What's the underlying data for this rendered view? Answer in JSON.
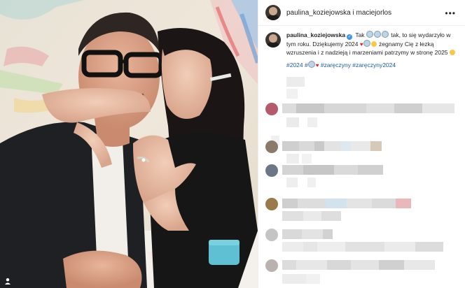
{
  "header": {
    "title": "paulina_koziejowska i maciejorlos",
    "more_icon": "more-dots-icon"
  },
  "caption": {
    "username": "paulina_koziejowska",
    "text_1": "Tak",
    "text_2": "tak, to się wydarzyło w tym roku. Dziękujemy 2024",
    "text_3": "żegnamy Cię z łezką wzruszenia i z nadzieją i marzeniami patrzymy w stronę 2025",
    "tags": "#2024 #",
    "tags_2": "#zaręczyny #zaręczyny2024"
  },
  "colors": {
    "link": "#1e5aa8",
    "verified": "#3897f0",
    "divider": "#efefef"
  }
}
